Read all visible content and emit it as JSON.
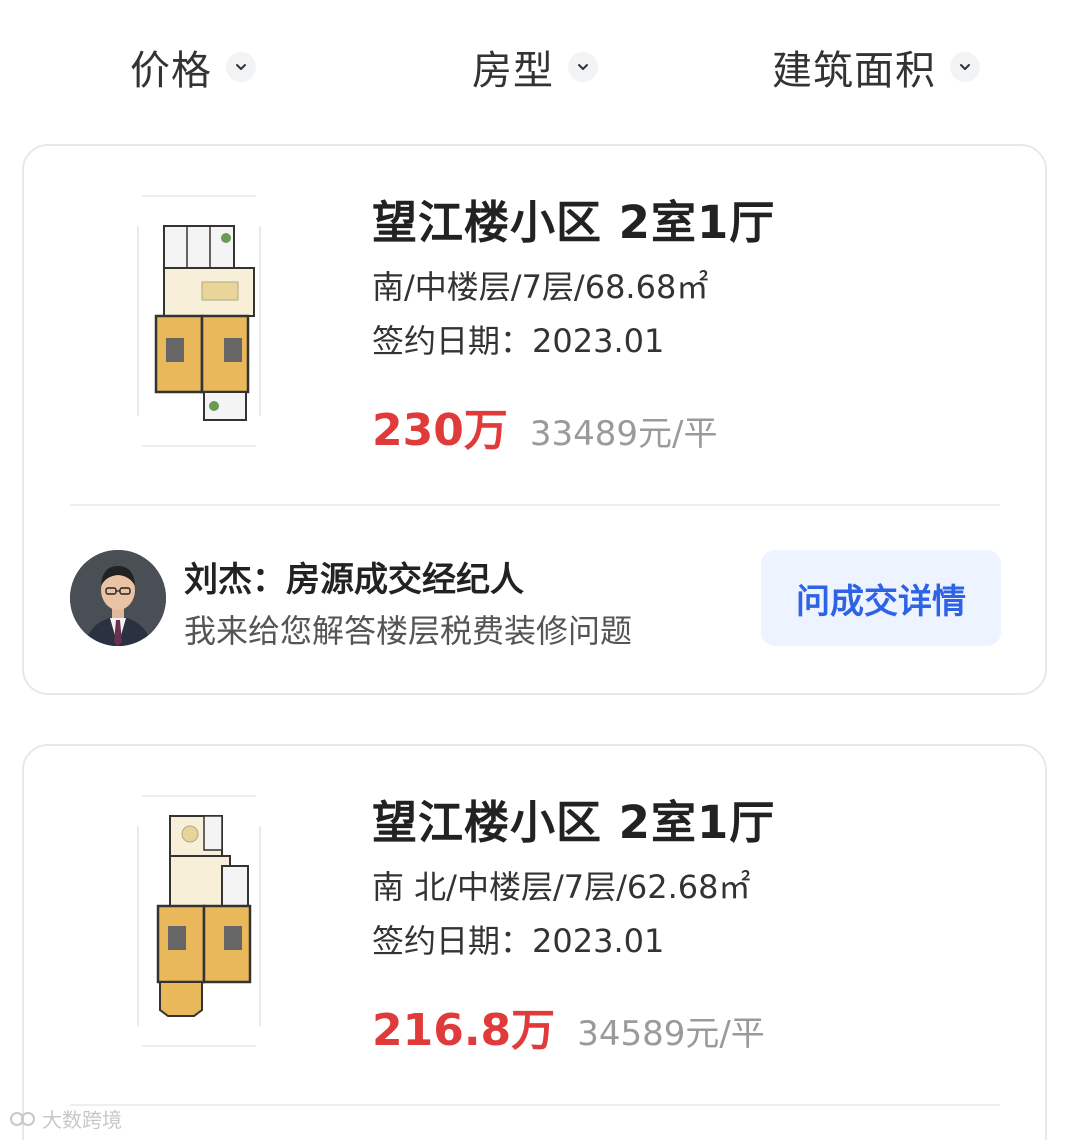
{
  "filters": [
    {
      "label": "价格"
    },
    {
      "label": "房型"
    },
    {
      "label": "建筑面积"
    }
  ],
  "listings": [
    {
      "title": "望江楼小区 2室1厅",
      "info": "南/中楼层/7层/68.68㎡",
      "date": "签约日期：2023.01",
      "price": "230万",
      "unit_price": "33489元/平",
      "agent": {
        "name": "刘杰：房源成交经纪人",
        "desc": "我来给您解答楼层税费装修问题",
        "button": "问成交详情"
      }
    },
    {
      "title": "望江楼小区 2室1厅",
      "info": "南 北/中楼层/7层/62.68㎡",
      "date": "签约日期：2023.01",
      "price": "216.8万",
      "unit_price": "34589元/平"
    }
  ],
  "watermark": "大数跨境",
  "colors": {
    "price": "#e03a3a",
    "button_text": "#2f63e6",
    "button_bg": "#eef4ff"
  }
}
